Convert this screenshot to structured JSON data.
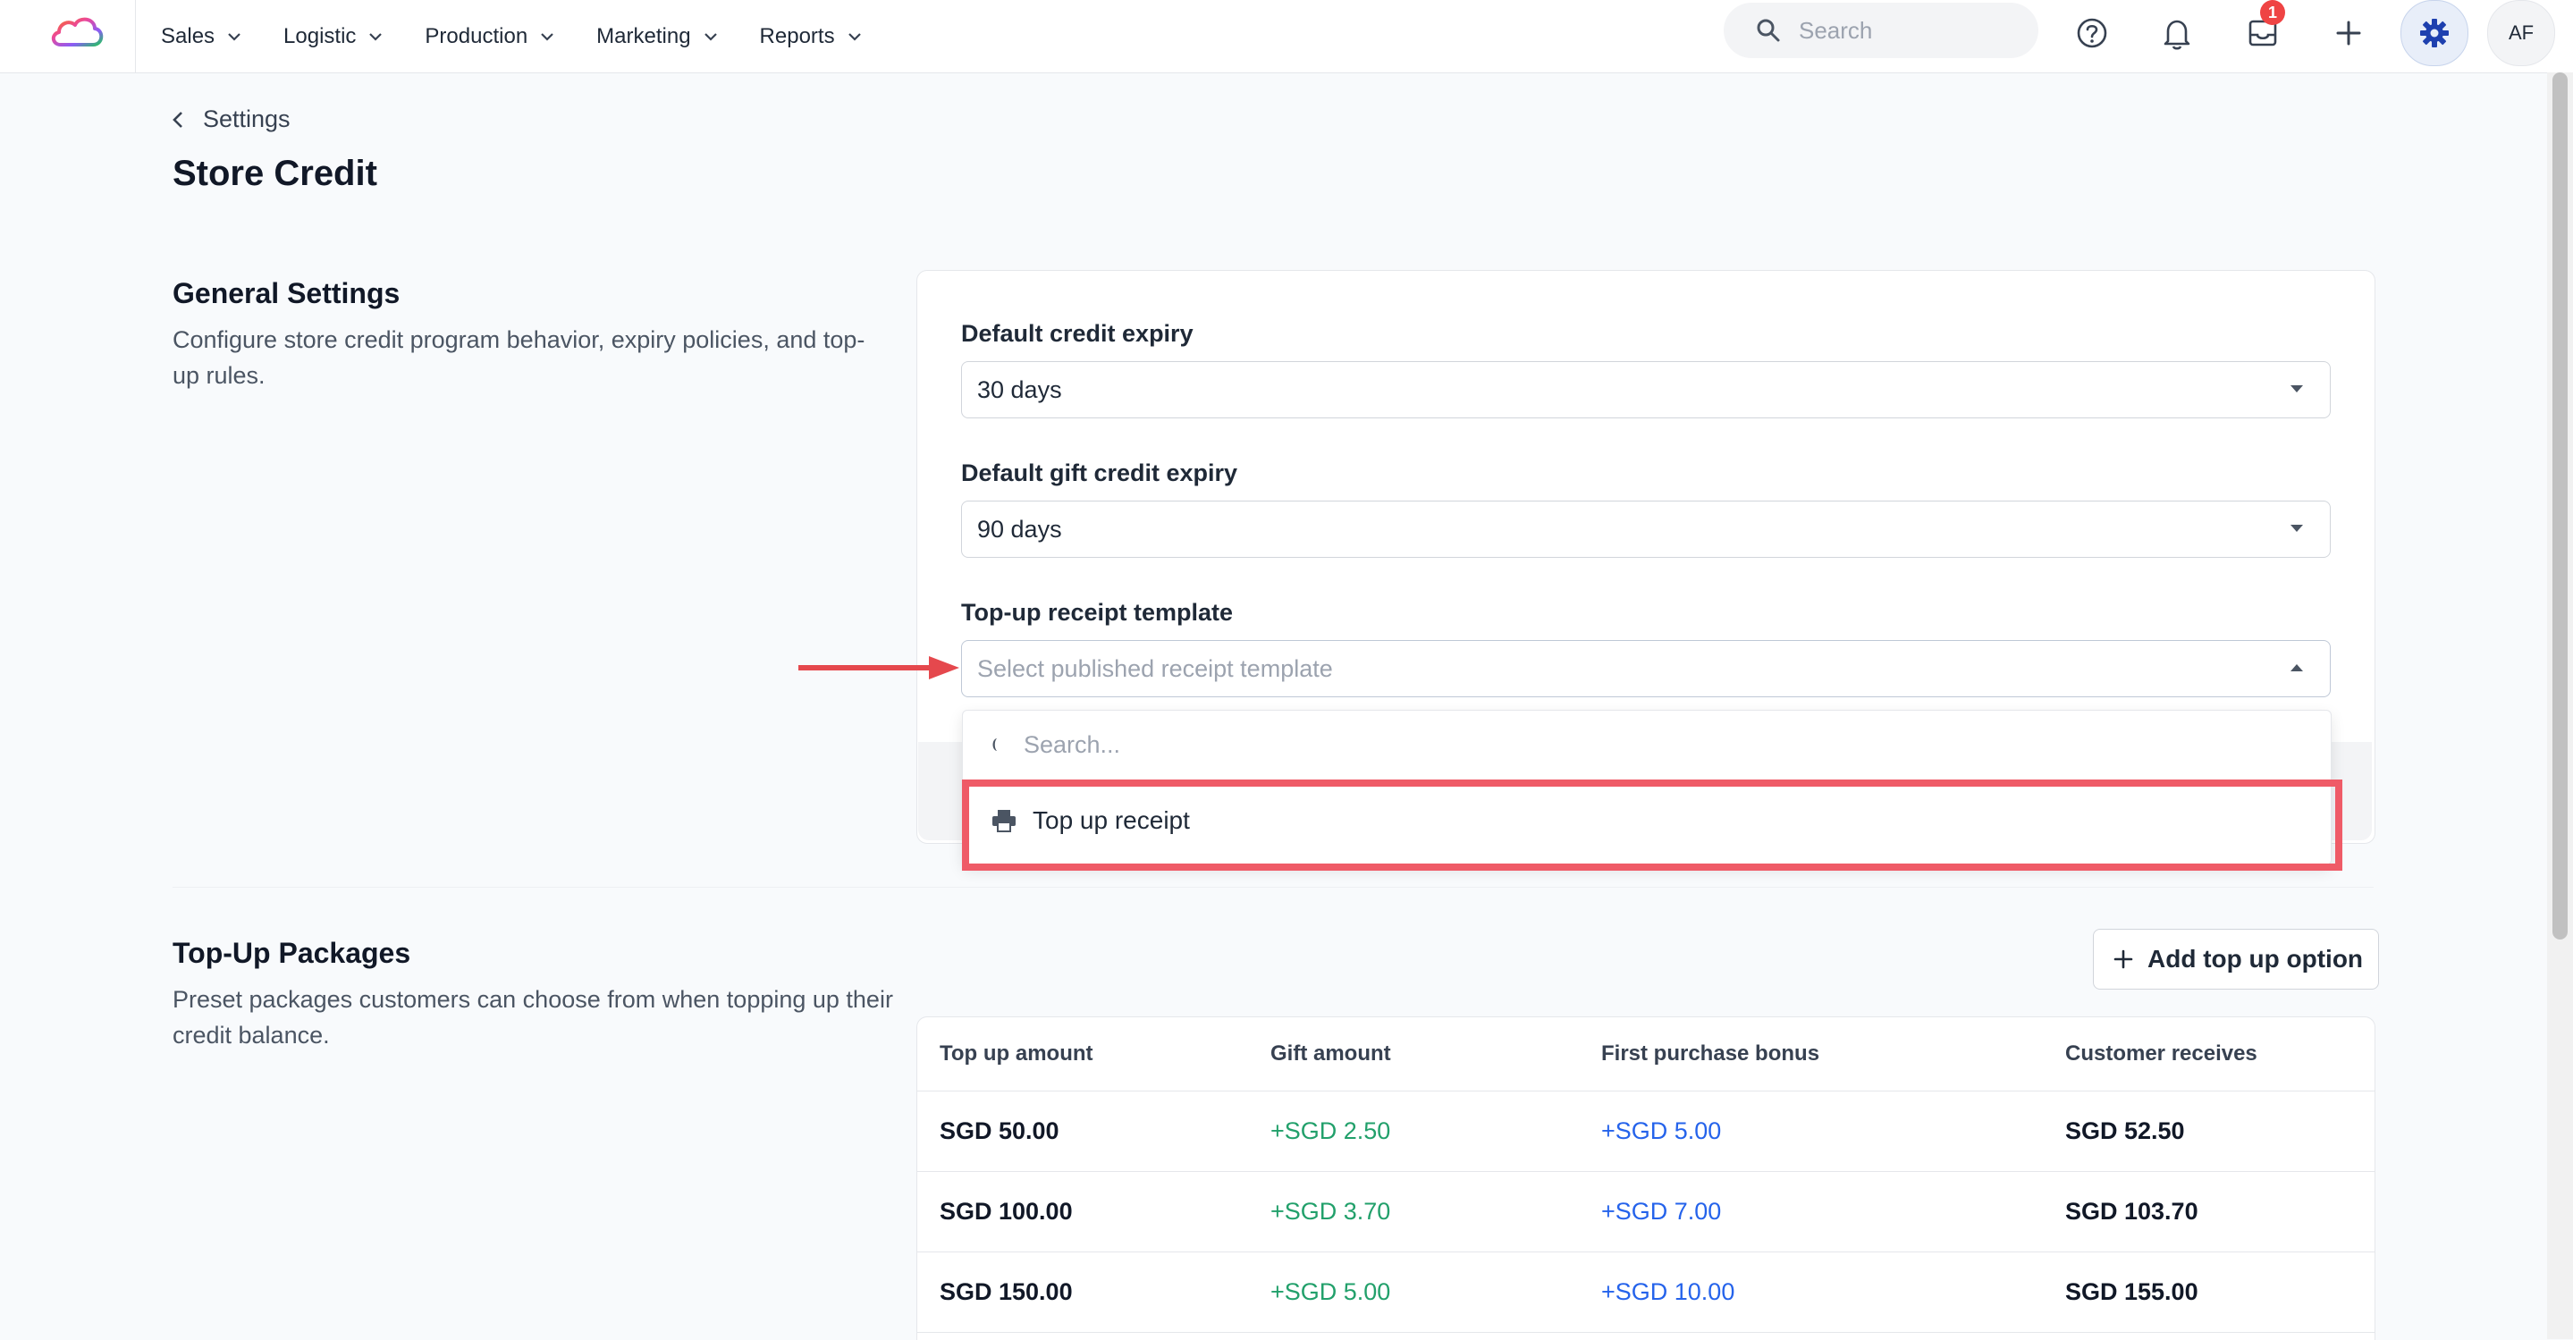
{
  "nav": {
    "items": [
      {
        "label": "Sales"
      },
      {
        "label": "Logistic"
      },
      {
        "label": "Production"
      },
      {
        "label": "Marketing"
      },
      {
        "label": "Reports"
      }
    ],
    "search_placeholder": "Search",
    "inbox_badge": "1",
    "avatar_initials": "AF"
  },
  "header": {
    "breadcrumb": "Settings",
    "title": "Store Credit"
  },
  "general": {
    "title": "General Settings",
    "description": "Configure store credit program behavior, expiry policies, and top-up rules.",
    "fields": {
      "credit_expiry": {
        "label": "Default credit expiry",
        "value": "30 days"
      },
      "gift_expiry": {
        "label": "Default gift credit expiry",
        "value": "90 days"
      },
      "receipt_template": {
        "label": "Top-up receipt template",
        "placeholder": "Select published receipt template"
      }
    },
    "dropdown": {
      "search_placeholder": "Search...",
      "options": [
        {
          "label": "Top up receipt",
          "icon": "printer-icon"
        }
      ]
    }
  },
  "packages": {
    "title": "Top-Up Packages",
    "description": "Preset packages customers can choose from when topping up their credit balance.",
    "add_button": "Add top up option",
    "columns": [
      "Top up amount",
      "Gift amount",
      "First purchase bonus",
      "Customer receives"
    ],
    "rows": [
      [
        "SGD 50.00",
        "+SGD 2.50",
        "+SGD 5.00",
        "SGD 52.50"
      ],
      [
        "SGD 100.00",
        "+SGD 3.70",
        "+SGD 7.00",
        "SGD 103.70"
      ],
      [
        "SGD 150.00",
        "+SGD 5.00",
        "+SGD 10.00",
        "SGD 155.00"
      ]
    ]
  },
  "colors": {
    "accent": "#1e40af",
    "highlight": "#ef5b67",
    "gift_green": "#22a06b",
    "bonus_blue": "#2563eb",
    "badge_red": "#ef4444"
  }
}
